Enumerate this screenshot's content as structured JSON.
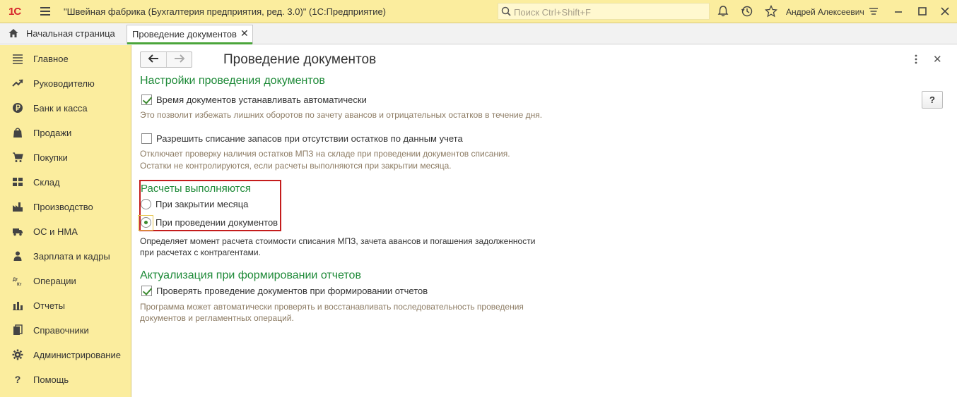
{
  "titlebar": {
    "logo": "1С",
    "app_title": "\"Швейная фабрика (Бухгалтерия предприятия, ред. 3.0)\"  (1С:Предприятие)",
    "search_placeholder": "Поиск Ctrl+Shift+F",
    "user": "Андрей Алексеевич",
    "icons": [
      "bell-icon",
      "history-icon",
      "star-icon",
      "settings-menu-icon",
      "minimize-icon",
      "maximize-icon",
      "close-icon"
    ]
  },
  "tabs": {
    "home_label": "Начальная страница",
    "active_label": "Проведение документов",
    "close_glyph": "✕"
  },
  "sidebar": {
    "items": [
      {
        "label": "Главное",
        "icon": "menu-icon"
      },
      {
        "label": "Руководителю",
        "icon": "trend-icon"
      },
      {
        "label": "Банк и касса",
        "icon": "ruble-icon"
      },
      {
        "label": "Продажи",
        "icon": "bag-icon"
      },
      {
        "label": "Покупки",
        "icon": "cart-icon"
      },
      {
        "label": "Склад",
        "icon": "warehouse-icon"
      },
      {
        "label": "Производство",
        "icon": "factory-icon"
      },
      {
        "label": "ОС и НМА",
        "icon": "truck-icon"
      },
      {
        "label": "Зарплата и кадры",
        "icon": "person-icon"
      },
      {
        "label": "Операции",
        "icon": "dt-kt-icon"
      },
      {
        "label": "Отчеты",
        "icon": "chart-icon"
      },
      {
        "label": "Справочники",
        "icon": "books-icon"
      },
      {
        "label": "Администрирование",
        "icon": "gear-icon"
      },
      {
        "label": "Помощь",
        "icon": "question-icon"
      }
    ]
  },
  "main": {
    "title": "Проведение документов",
    "help_label": "?",
    "section1": {
      "heading": "Настройки проведения документов",
      "opt1": {
        "label": "Время документов устанавливать автоматически",
        "checked": true
      },
      "hint1": "Это позволит избежать лишних оборотов по зачету авансов и отрицательных остатков в течение дня.",
      "opt2": {
        "label": "Разрешить списание запасов при отсутствии остатков по данным учета",
        "checked": false
      },
      "hint2_line1": "Отключает проверку наличия остатков МПЗ на складе при проведении документов списания.",
      "hint2_line2": "Остатки не контролируются, если расчеты выполняются при закрытии месяца."
    },
    "section2": {
      "heading": "Расчеты выполняются",
      "radio1": "При закрытии месяца",
      "radio2": "При проведении документов",
      "selected": "radio2",
      "note_line1": "Определяет момент расчета стоимости списания МПЗ, зачета авансов и погашения задолженности",
      "note_line2": "при расчетах с контрагентами."
    },
    "section3": {
      "heading": "Актуализация при формировании отчетов",
      "opt": {
        "label": "Проверять проведение документов при формировании отчетов",
        "checked": true
      },
      "hint_line1": "Программа может автоматически проверять и восстанавливать последовательность проведения",
      "hint_line2": "документов и регламентных операций."
    }
  },
  "colors": {
    "panel_yellow": "#fbed9e",
    "heading_green": "#1e8a38",
    "hint_brown": "#8c7b63",
    "highlight_red": "#c41c1c",
    "tab_accent": "#4ba53b"
  }
}
